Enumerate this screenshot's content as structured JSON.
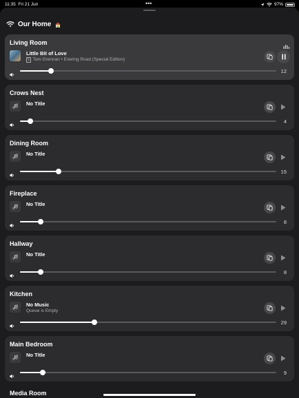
{
  "status_bar": {
    "time": "11:35",
    "date": "Fri 21 Jun",
    "battery": "97%"
  },
  "home": {
    "title": "Our Home",
    "icon": "house-icon"
  },
  "rooms": [
    {
      "name": "Living Room",
      "title": "Little Bit of Love",
      "subtitle": "Tom Grennan • Evering Road (Special Edition)",
      "explicit": true,
      "volume": 12,
      "playing": true
    },
    {
      "name": "Crows Nest",
      "title": "No Title",
      "subtitle": "",
      "volume": 4,
      "playing": false
    },
    {
      "name": "Dining Room",
      "title": "No Title",
      "subtitle": "",
      "volume": 15,
      "playing": false
    },
    {
      "name": "Fireplace",
      "title": "No Title",
      "subtitle": "",
      "volume": 8,
      "playing": false
    },
    {
      "name": "Hallway",
      "title": "No Title",
      "subtitle": "",
      "volume": 8,
      "playing": false
    },
    {
      "name": "Kitchen",
      "title": "No Music",
      "subtitle": "Queue is Empty",
      "volume": 29,
      "playing": false
    },
    {
      "name": "Main Bedroom",
      "title": "No Title",
      "subtitle": "",
      "volume": 9,
      "playing": false
    }
  ],
  "partial_room": {
    "name": "Media Room"
  },
  "colors": {
    "background": "#000000",
    "sheet": "#1c1c1e",
    "card": "#2c2c2e",
    "card_active": "#3a3a3c"
  }
}
